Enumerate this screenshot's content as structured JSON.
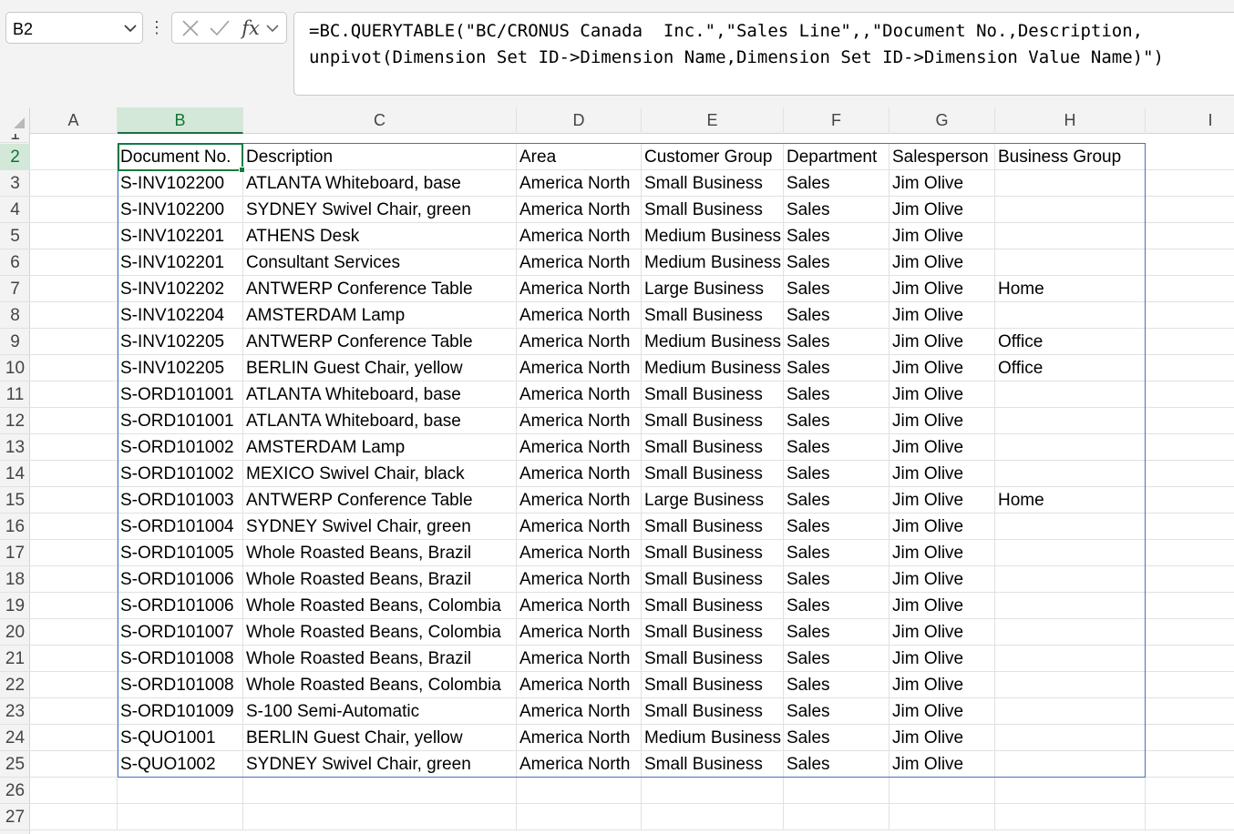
{
  "name_box": {
    "value": "B2"
  },
  "formula_bar": {
    "formula": "=BC.QUERYTABLE(\"BC/CRONUS Canada  Inc.\",\"Sales Line\",,\"Document No.,Description,\nunpivot(Dimension Set ID->Dimension Name,Dimension Set ID->Dimension Value Name)\")",
    "fx_label": "fx"
  },
  "columns": [
    "A",
    "B",
    "C",
    "D",
    "E",
    "F",
    "G",
    "H",
    "I"
  ],
  "selected_column": "B",
  "row_numbers": [
    "1",
    "2",
    "3",
    "4",
    "5",
    "6",
    "7",
    "8",
    "9",
    "10",
    "11",
    "12",
    "13",
    "14",
    "15",
    "16",
    "17",
    "18",
    "19",
    "20",
    "21",
    "22",
    "23",
    "24",
    "25",
    "26",
    "27"
  ],
  "selected_row": "2",
  "table": {
    "headers": [
      "Document No.",
      "Description",
      "Area",
      "Customer Group",
      "Department",
      "Salesperson",
      "Business Group"
    ],
    "rows": [
      [
        "S-INV102200",
        "ATLANTA Whiteboard, base",
        "America North",
        "Small Business",
        "Sales",
        "Jim Olive",
        ""
      ],
      [
        "S-INV102200",
        "SYDNEY Swivel Chair, green",
        "America North",
        "Small Business",
        "Sales",
        "Jim Olive",
        ""
      ],
      [
        "S-INV102201",
        "ATHENS Desk",
        "America North",
        "Medium Business",
        "Sales",
        "Jim Olive",
        ""
      ],
      [
        "S-INV102201",
        "Consultant Services",
        "America North",
        "Medium Business",
        "Sales",
        "Jim Olive",
        ""
      ],
      [
        "S-INV102202",
        "ANTWERP Conference Table",
        "America North",
        "Large Business",
        "Sales",
        "Jim Olive",
        "Home"
      ],
      [
        "S-INV102204",
        "AMSTERDAM Lamp",
        "America North",
        "Small Business",
        "Sales",
        "Jim Olive",
        ""
      ],
      [
        "S-INV102205",
        "ANTWERP Conference Table",
        "America North",
        "Medium Business",
        "Sales",
        "Jim Olive",
        "Office"
      ],
      [
        "S-INV102205",
        "BERLIN Guest Chair, yellow",
        "America North",
        "Medium Business",
        "Sales",
        "Jim Olive",
        "Office"
      ],
      [
        "S-ORD101001",
        "ATLANTA Whiteboard, base",
        "America North",
        "Small Business",
        "Sales",
        "Jim Olive",
        ""
      ],
      [
        "S-ORD101001",
        "ATLANTA Whiteboard, base",
        "America North",
        "Small Business",
        "Sales",
        "Jim Olive",
        ""
      ],
      [
        "S-ORD101002",
        "AMSTERDAM Lamp",
        "America North",
        "Small Business",
        "Sales",
        "Jim Olive",
        ""
      ],
      [
        "S-ORD101002",
        "MEXICO Swivel Chair, black",
        "America North",
        "Small Business",
        "Sales",
        "Jim Olive",
        ""
      ],
      [
        "S-ORD101003",
        "ANTWERP Conference Table",
        "America North",
        "Large Business",
        "Sales",
        "Jim Olive",
        "Home"
      ],
      [
        "S-ORD101004",
        "SYDNEY Swivel Chair, green",
        "America North",
        "Small Business",
        "Sales",
        "Jim Olive",
        ""
      ],
      [
        "S-ORD101005",
        "Whole Roasted Beans, Brazil",
        "America North",
        "Small Business",
        "Sales",
        "Jim Olive",
        ""
      ],
      [
        "S-ORD101006",
        "Whole Roasted Beans, Brazil",
        "America North",
        "Small Business",
        "Sales",
        "Jim Olive",
        ""
      ],
      [
        "S-ORD101006",
        "Whole Roasted Beans, Colombia",
        "America North",
        "Small Business",
        "Sales",
        "Jim Olive",
        ""
      ],
      [
        "S-ORD101007",
        "Whole Roasted Beans, Colombia",
        "America North",
        "Small Business",
        "Sales",
        "Jim Olive",
        ""
      ],
      [
        "S-ORD101008",
        "Whole Roasted Beans, Brazil",
        "America North",
        "Small Business",
        "Sales",
        "Jim Olive",
        ""
      ],
      [
        "S-ORD101008",
        "Whole Roasted Beans, Colombia",
        "America North",
        "Small Business",
        "Sales",
        "Jim Olive",
        ""
      ],
      [
        "S-ORD101009",
        "S-100 Semi-Automatic",
        "America North",
        "Small Business",
        "Sales",
        "Jim Olive",
        ""
      ],
      [
        "S-QUO1001",
        "BERLIN Guest Chair, yellow",
        "America North",
        "Medium Business",
        "Sales",
        "Jim Olive",
        ""
      ],
      [
        "S-QUO1002",
        "SYDNEY Swivel Chair, green",
        "America North",
        "Small Business",
        "Sales",
        "Jim Olive",
        ""
      ]
    ]
  },
  "colors": {
    "accent": "#107c41",
    "table_border": "#4472c4",
    "selected_header_bg": "#d3e8d8"
  }
}
